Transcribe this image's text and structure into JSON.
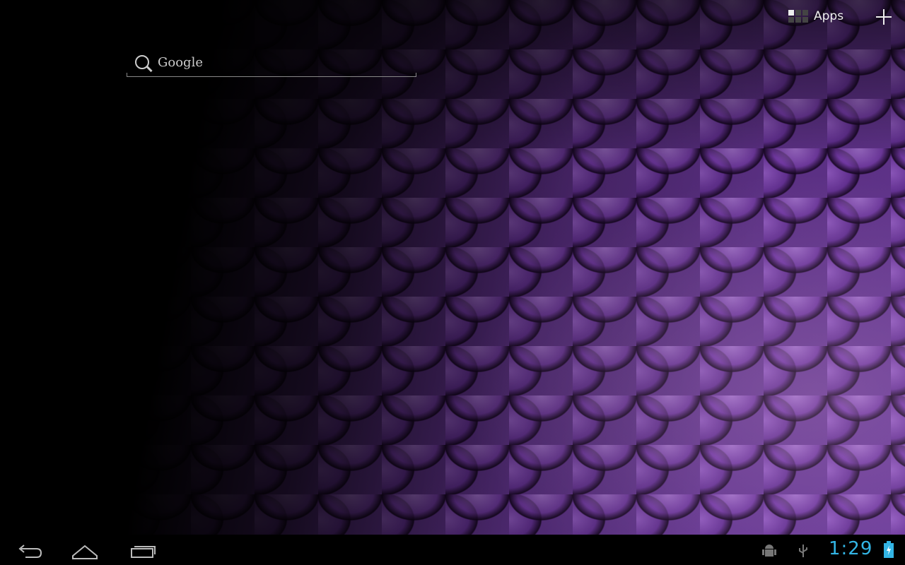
{
  "search": {
    "label": "Google"
  },
  "topbar": {
    "apps_label": "Apps"
  },
  "statusbar": {
    "time": "1:29"
  },
  "colors": {
    "accent": "#33b5e5",
    "wallpaper": "#7a45b0"
  }
}
